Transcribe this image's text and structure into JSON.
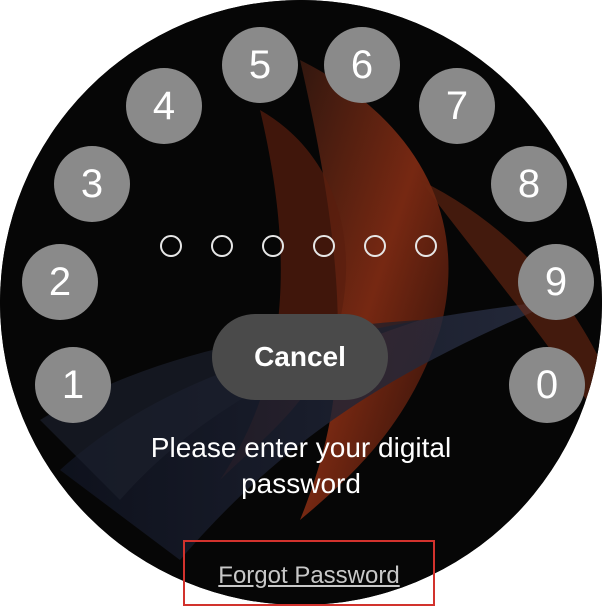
{
  "keypad": {
    "keys": [
      "1",
      "2",
      "3",
      "4",
      "5",
      "6",
      "7",
      "8",
      "9",
      "0"
    ]
  },
  "password": {
    "length": 6,
    "filled": 0
  },
  "cancel_label": "Cancel",
  "prompt": "Please enter your digital password",
  "forgot_label": "Forgot Password",
  "colors": {
    "key_fill": "#8a8a8a",
    "cancel_fill": "#4a4a4a",
    "highlight_border": "#d2322d",
    "wallpaper_accent": "#b9421c"
  }
}
